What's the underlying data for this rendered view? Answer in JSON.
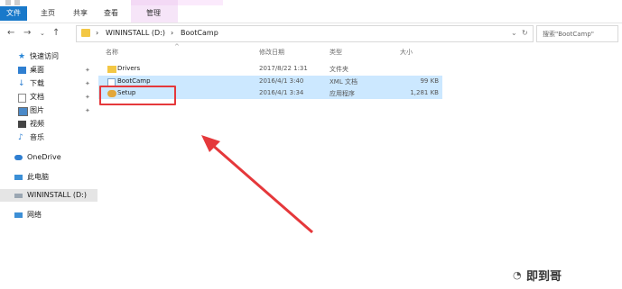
{
  "ribbon": {
    "tabs": [
      "文件",
      "主页",
      "共享",
      "查看"
    ],
    "contextual_tab": "管理"
  },
  "address": {
    "path": [
      "WININSTALL (D:)",
      "BootCamp"
    ],
    "separator": "›",
    "search_placeholder": "搜索\"BootCamp\""
  },
  "nav": {
    "quick_access": "快速访问",
    "items": [
      "桌面",
      "下载",
      "文档",
      "图片",
      "视频",
      "音乐"
    ],
    "onedrive": "OneDrive",
    "this_pc": "此电脑",
    "drive": "WININSTALL (D:)",
    "network": "网络"
  },
  "columns": [
    "名称",
    "修改日期",
    "类型",
    "大小"
  ],
  "files": [
    {
      "name": "Drivers",
      "date": "2017/8/22 1:31",
      "type": "文件夹",
      "size": "",
      "icon": "folder-icon"
    },
    {
      "name": "BootCamp",
      "date": "2016/4/1 3:40",
      "type": "XML 文档",
      "size": "99 KB",
      "icon": "xml-file-icon"
    },
    {
      "name": "Setup",
      "date": "2016/4/1 3:34",
      "type": "应用程序",
      "size": "1,281 KB",
      "icon": "setup-app-icon"
    }
  ],
  "colors": {
    "selection": "#cce8ff",
    "highlight_box": "#e5383b",
    "arrow": "#e5383b",
    "file_tab": "#1979ca"
  },
  "watermark": "即到哥"
}
